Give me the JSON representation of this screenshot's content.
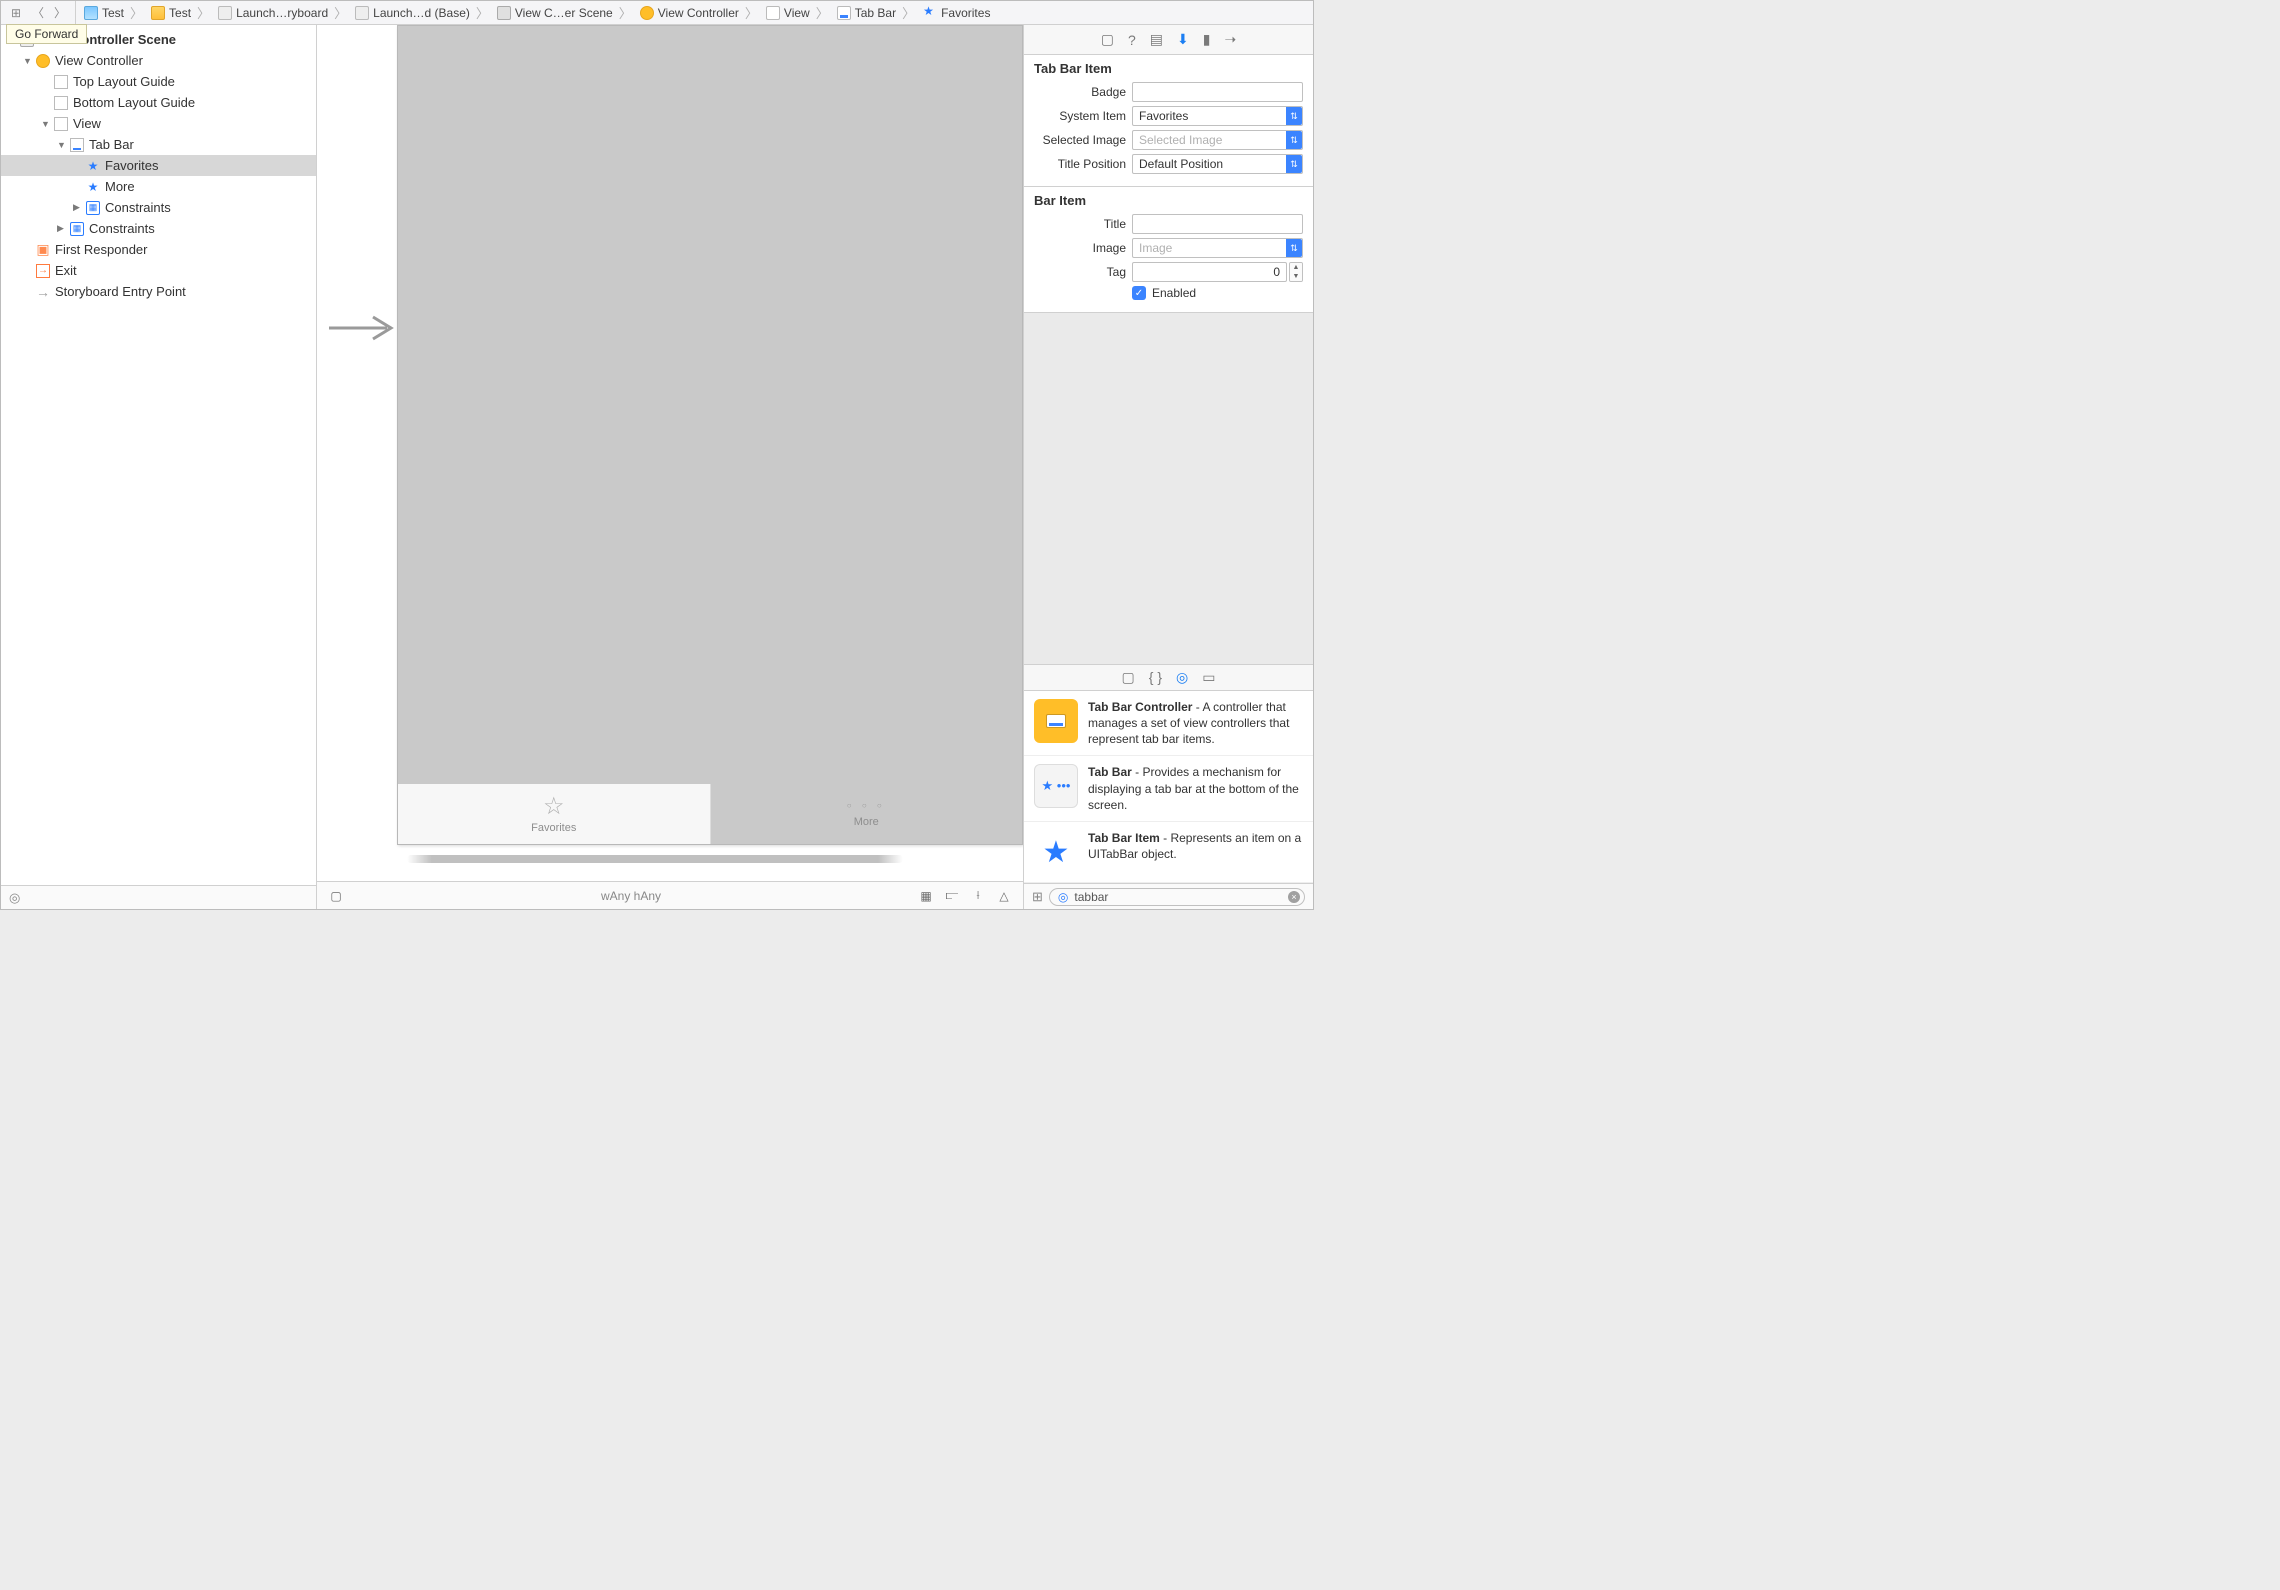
{
  "tooltip": "Go Forward",
  "breadcrumbs": [
    {
      "icon": "image",
      "label": "Test"
    },
    {
      "icon": "folder",
      "label": "Test"
    },
    {
      "icon": "file",
      "label": "Launch…ryboard"
    },
    {
      "icon": "file",
      "label": "Launch…d (Base)"
    },
    {
      "icon": "scene",
      "label": "View C…er Scene"
    },
    {
      "icon": "vc",
      "label": "View Controller"
    },
    {
      "icon": "view",
      "label": "View"
    },
    {
      "icon": "tabbar",
      "label": "Tab Bar"
    },
    {
      "icon": "star",
      "label": "Favorites"
    }
  ],
  "outline": {
    "scene": "View Controller Scene",
    "vc": "View Controller",
    "tlg": "Top Layout Guide",
    "blg": "Bottom Layout Guide",
    "view": "View",
    "tabbar": "Tab Bar",
    "fav": "Favorites",
    "more": "More",
    "constraints1": "Constraints",
    "constraints2": "Constraints",
    "first_responder": "First Responder",
    "exit": "Exit",
    "entry": "Storyboard Entry Point"
  },
  "canvas": {
    "tab1": "Favorites",
    "tab2": "More",
    "size_class": "wAny hAny"
  },
  "inspector": {
    "section1_title": "Tab Bar Item",
    "labels": {
      "badge": "Badge",
      "system_item": "System Item",
      "selected_image": "Selected Image",
      "title_position": "Title Position",
      "title": "Title",
      "image": "Image",
      "tag": "Tag",
      "enabled": "Enabled"
    },
    "values": {
      "badge": "",
      "system_item": "Favorites",
      "selected_image_placeholder": "Selected Image",
      "title_position": "Default Position",
      "title": "",
      "image_placeholder": "Image",
      "tag": "0"
    },
    "section2_title": "Bar Item"
  },
  "library": {
    "items": [
      {
        "title": "Tab Bar Controller",
        "desc": " - A controller that manages a set of view controllers that represent tab bar items."
      },
      {
        "title": "Tab Bar",
        "desc": " - Provides a mechanism for displaying a tab bar at the bottom of the screen."
      },
      {
        "title": "Tab Bar Item",
        "desc": " - Represents an item on a UITabBar object."
      }
    ],
    "search": "tabbar"
  }
}
